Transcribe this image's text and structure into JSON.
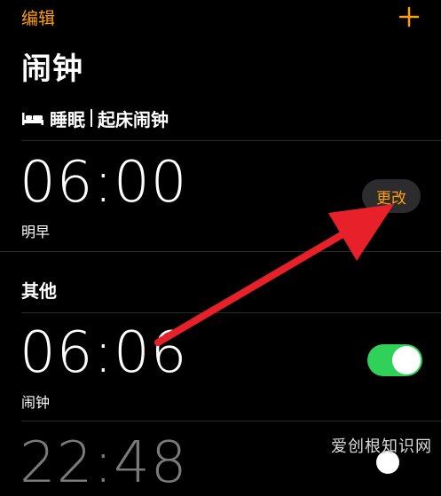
{
  "nav": {
    "edit_label": "编辑",
    "add_icon": "plus-icon"
  },
  "page": {
    "title": "闹钟"
  },
  "sleep": {
    "icon": "bed-icon",
    "label_left": "睡眠",
    "label_right": "起床闹钟",
    "time": "06:00",
    "sublabel": "明早",
    "change_label": "更改"
  },
  "other": {
    "section_title": "其他",
    "alarms": [
      {
        "time": "06:06",
        "label": "闹钟",
        "enabled": true
      },
      {
        "time": "22:48",
        "label": "",
        "enabled": true
      }
    ]
  },
  "watermark": {
    "text": "爱创根知识网"
  },
  "colors": {
    "accent": "#ff9f0a",
    "toggle_on": "#30d158",
    "annotation_arrow": "#e8202a"
  }
}
